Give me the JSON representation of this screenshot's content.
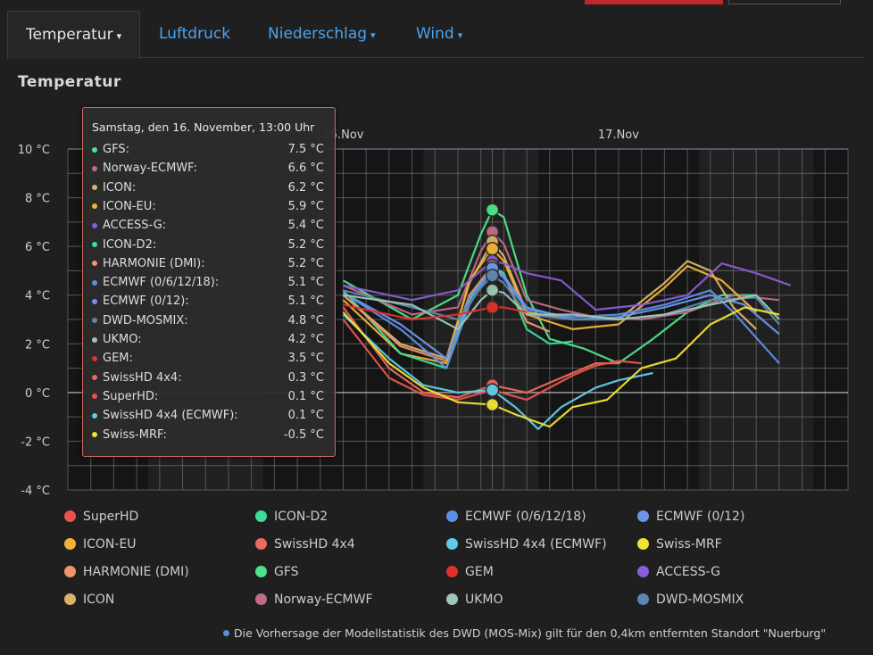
{
  "tabs": [
    {
      "label": "Temperatur",
      "caret": "▾"
    },
    {
      "label": "Luftdruck",
      "caret": ""
    },
    {
      "label": "Niederschlag",
      "caret": "▾"
    },
    {
      "label": "Wind",
      "caret": "▾"
    }
  ],
  "section_title": "Temperatur",
  "footnote": "Die Vorhersage der Modellstatistik des DWD (MOS-Mix) gilt für den 0,4km entfernten Standort \"Nuerburg\"",
  "tooltip": {
    "header": "Samstag, den 16. November, 13:00 Uhr",
    "rows": [
      {
        "name": "GFS:",
        "value": "7.5 °C",
        "color": "#4ee38a"
      },
      {
        "name": "Norway-ECMWF:",
        "value": "6.6 °C",
        "color": "#c06b86"
      },
      {
        "name": "ICON:",
        "value": "6.2 °C",
        "color": "#d9b36a"
      },
      {
        "name": "ICON-EU:",
        "value": "5.9 °C",
        "color": "#f2b233"
      },
      {
        "name": "ACCESS-G:",
        "value": "5.4 °C",
        "color": "#8a5cd6"
      },
      {
        "name": "ICON-D2:",
        "value": "5.2 °C",
        "color": "#3ddc97"
      },
      {
        "name": "HARMONIE (DMI):",
        "value": "5.2 °C",
        "color": "#f0956a"
      },
      {
        "name": "ECMWF (0/6/12/18):",
        "value": "5.1 °C",
        "color": "#5b8fe6"
      },
      {
        "name": "ECMWF (0/12):",
        "value": "5.1 °C",
        "color": "#6f93e8"
      },
      {
        "name": "DWD-MOSMIX:",
        "value": "4.8 °C",
        "color": "#5f86b0"
      },
      {
        "name": "UKMO:",
        "value": "4.2 °C",
        "color": "#9cc7b4"
      },
      {
        "name": "GEM:",
        "value": "3.5 °C",
        "color": "#e0312c"
      },
      {
        "name": "SwissHD 4x4:",
        "value": "0.3 °C",
        "color": "#ec6a5c"
      },
      {
        "name": "SuperHD:",
        "value": "0.1 °C",
        "color": "#e8534f"
      },
      {
        "name": "SwissHD 4x4 (ECMWF):",
        "value": "0.1 °C",
        "color": "#5fcbe8"
      },
      {
        "name": "Swiss-MRF:",
        "value": "-0.5 °C",
        "color": "#f2e233"
      }
    ]
  },
  "legend": [
    {
      "label": "SuperHD",
      "color": "#e8534f"
    },
    {
      "label": "ICON-D2",
      "color": "#3ddc97"
    },
    {
      "label": "ECMWF (0/6/12/18)",
      "color": "#5b8fe6"
    },
    {
      "label": "ECMWF (0/12)",
      "color": "#6f93e8"
    },
    {
      "label": "ICON-EU",
      "color": "#f2b233"
    },
    {
      "label": "SwissHD 4x4",
      "color": "#ec6a5c"
    },
    {
      "label": "SwissHD 4x4 (ECMWF)",
      "color": "#5fcbe8"
    },
    {
      "label": "Swiss-MRF",
      "color": "#f2e233"
    },
    {
      "label": "HARMONIE (DMI)",
      "color": "#f0956a"
    },
    {
      "label": "GFS",
      "color": "#4ee38a"
    },
    {
      "label": "GEM",
      "color": "#e0312c"
    },
    {
      "label": "ACCESS-G",
      "color": "#8a5cd6"
    },
    {
      "label": "ICON",
      "color": "#d9b36a"
    },
    {
      "label": "Norway-ECMWF",
      "color": "#c06b86"
    },
    {
      "label": "UKMO",
      "color": "#9cc7b4"
    },
    {
      "label": "DWD-MOSMIX",
      "color": "#5f86b0"
    }
  ],
  "chart_data": {
    "type": "line",
    "title": "Temperatur",
    "xlabel": "",
    "ylabel": "",
    "x_unit": "hour from 15 Nov 00:00",
    "x_range": [
      0,
      68
    ],
    "x_tick_labels": [
      {
        "label": "16.Nov",
        "x": 24
      },
      {
        "label": "17.Nov",
        "x": 48
      }
    ],
    "ylim": [
      -4,
      10
    ],
    "y_ticks": [
      -4,
      -2,
      0,
      2,
      4,
      6,
      8,
      10
    ],
    "y_tick_labels": [
      "-4 °C",
      "-2 °C",
      "0 °C",
      "2 °C",
      "4 °C",
      "6 °C",
      "8 °C",
      "10 °C"
    ],
    "grid": true,
    "highlight_x": 37,
    "series": [
      {
        "name": "GFS",
        "color": "#4ee38a",
        "points": [
          [
            24,
            4.6
          ],
          [
            30,
            3.0
          ],
          [
            34,
            4.0
          ],
          [
            36,
            6.5
          ],
          [
            37,
            7.5
          ],
          [
            38,
            7.2
          ],
          [
            40,
            4.0
          ],
          [
            42,
            2.2
          ],
          [
            45,
            1.8
          ],
          [
            48,
            1.2
          ],
          [
            51,
            2.2
          ],
          [
            54,
            3.3
          ],
          [
            57,
            4.0
          ],
          [
            60,
            4.0
          ]
        ]
      },
      {
        "name": "Norway-ECMWF",
        "color": "#c06b86",
        "points": [
          [
            24,
            4.4
          ],
          [
            30,
            3.2
          ],
          [
            34,
            3.5
          ],
          [
            36,
            5.8
          ],
          [
            37,
            6.6
          ],
          [
            38,
            6.1
          ],
          [
            40,
            3.8
          ],
          [
            43,
            3.4
          ],
          [
            46,
            3.1
          ],
          [
            50,
            3.0
          ],
          [
            54,
            3.3
          ],
          [
            58,
            4.0
          ],
          [
            62,
            3.8
          ]
        ]
      },
      {
        "name": "ICON",
        "color": "#d9b36a",
        "points": [
          [
            24,
            4.0
          ],
          [
            29,
            2.0
          ],
          [
            33,
            1.4
          ],
          [
            35,
            4.5
          ],
          [
            37,
            6.2
          ],
          [
            38,
            5.6
          ],
          [
            40,
            3.3
          ],
          [
            44,
            3.0
          ],
          [
            48,
            3.0
          ],
          [
            52,
            4.5
          ],
          [
            54,
            5.4
          ],
          [
            56,
            5.0
          ],
          [
            58,
            3.5
          ],
          [
            60,
            2.6
          ]
        ]
      },
      {
        "name": "ICON-EU",
        "color": "#f2b233",
        "points": [
          [
            24,
            3.8
          ],
          [
            29,
            1.6
          ],
          [
            33,
            1.2
          ],
          [
            35,
            4.6
          ],
          [
            37,
            5.9
          ],
          [
            38,
            5.4
          ],
          [
            40,
            3.2
          ],
          [
            44,
            2.6
          ],
          [
            48,
            2.8
          ],
          [
            52,
            4.3
          ],
          [
            54,
            5.2
          ],
          [
            57,
            4.6
          ],
          [
            60,
            3.3
          ]
        ]
      },
      {
        "name": "ACCESS-G",
        "color": "#8a5cd6",
        "points": [
          [
            24,
            4.4
          ],
          [
            30,
            3.8
          ],
          [
            34,
            4.2
          ],
          [
            36,
            5.0
          ],
          [
            37,
            5.4
          ],
          [
            38,
            5.3
          ],
          [
            40,
            4.9
          ],
          [
            43,
            4.6
          ],
          [
            46,
            3.4
          ],
          [
            50,
            3.6
          ],
          [
            54,
            4.0
          ],
          [
            57,
            5.3
          ],
          [
            60,
            4.9
          ],
          [
            63,
            4.4
          ]
        ]
      },
      {
        "name": "ICON-D2",
        "color": "#3ddc97",
        "points": [
          [
            24,
            4.2
          ],
          [
            29,
            1.6
          ],
          [
            33,
            1.0
          ],
          [
            35,
            3.8
          ],
          [
            37,
            5.2
          ],
          [
            38,
            4.9
          ],
          [
            40,
            2.6
          ],
          [
            42,
            2.0
          ],
          [
            44,
            2.1
          ]
        ]
      },
      {
        "name": "HARMONIE (DMI)",
        "color": "#f0956a",
        "points": [
          [
            24,
            4.0
          ],
          [
            29,
            1.9
          ],
          [
            33,
            1.3
          ],
          [
            35,
            4.0
          ],
          [
            37,
            5.2
          ],
          [
            38,
            4.8
          ],
          [
            40,
            2.9
          ],
          [
            42,
            2.5
          ]
        ]
      },
      {
        "name": "ECMWF (0/6/12/18)",
        "color": "#5b8fe6",
        "points": [
          [
            24,
            4.1
          ],
          [
            29,
            2.6
          ],
          [
            33,
            1.0
          ],
          [
            35,
            3.6
          ],
          [
            37,
            5.1
          ],
          [
            38,
            4.7
          ],
          [
            40,
            3.4
          ],
          [
            44,
            3.1
          ],
          [
            48,
            3.2
          ],
          [
            52,
            3.6
          ],
          [
            56,
            4.2
          ],
          [
            58,
            3.3
          ],
          [
            62,
            1.2
          ]
        ]
      },
      {
        "name": "ECMWF (0/12)",
        "color": "#6f93e8",
        "points": [
          [
            24,
            4.1
          ],
          [
            29,
            2.8
          ],
          [
            33,
            1.4
          ],
          [
            35,
            3.9
          ],
          [
            37,
            5.1
          ],
          [
            38,
            4.8
          ],
          [
            40,
            3.5
          ],
          [
            44,
            3.0
          ],
          [
            48,
            3.1
          ],
          [
            52,
            3.5
          ],
          [
            56,
            4.0
          ],
          [
            59,
            3.6
          ],
          [
            62,
            2.4
          ]
        ]
      },
      {
        "name": "DWD-MOSMIX",
        "color": "#5f86b0",
        "points": [
          [
            24,
            4.2
          ],
          [
            30,
            3.5
          ],
          [
            34,
            3.0
          ],
          [
            36,
            4.3
          ],
          [
            37,
            4.8
          ],
          [
            38,
            4.5
          ],
          [
            40,
            3.2
          ],
          [
            44,
            3.0
          ],
          [
            48,
            3.0
          ],
          [
            52,
            3.2
          ],
          [
            56,
            3.8
          ],
          [
            60,
            3.9
          ],
          [
            62,
            2.8
          ]
        ]
      },
      {
        "name": "UKMO",
        "color": "#9cc7b4",
        "points": [
          [
            24,
            4.0
          ],
          [
            30,
            3.6
          ],
          [
            34,
            2.6
          ],
          [
            36,
            3.8
          ],
          [
            37,
            4.2
          ],
          [
            38,
            4.1
          ],
          [
            40,
            3.2
          ],
          [
            44,
            3.2
          ],
          [
            48,
            3.0
          ],
          [
            52,
            3.2
          ],
          [
            56,
            3.6
          ],
          [
            60,
            4.0
          ],
          [
            62,
            3.0
          ]
        ]
      },
      {
        "name": "GEM",
        "color": "#e0312c",
        "points": [
          [
            24,
            3.6
          ],
          [
            30,
            3.0
          ],
          [
            34,
            3.2
          ],
          [
            36,
            3.4
          ],
          [
            37,
            3.5
          ],
          [
            38,
            3.5
          ],
          [
            40,
            3.3
          ]
        ]
      },
      {
        "name": "SwissHD 4x4",
        "color": "#ec6a5c",
        "points": [
          [
            24,
            3.5
          ],
          [
            28,
            1.0
          ],
          [
            31,
            0.0
          ],
          [
            34,
            -0.2
          ],
          [
            37,
            0.3
          ],
          [
            40,
            0.0
          ],
          [
            42,
            0.4
          ],
          [
            44,
            0.8
          ],
          [
            46,
            1.2
          ],
          [
            48,
            1.2
          ]
        ]
      },
      {
        "name": "SuperHD",
        "color": "#e8534f",
        "points": [
          [
            24,
            3.0
          ],
          [
            28,
            0.6
          ],
          [
            31,
            -0.1
          ],
          [
            34,
            -0.3
          ],
          [
            37,
            0.1
          ],
          [
            40,
            -0.3
          ],
          [
            42,
            0.2
          ],
          [
            44,
            0.7
          ],
          [
            46,
            1.1
          ],
          [
            48,
            1.3
          ],
          [
            50,
            1.2
          ]
        ]
      },
      {
        "name": "SwissHD 4x4 (ECMWF)",
        "color": "#5fcbe8",
        "points": [
          [
            24,
            3.2
          ],
          [
            28,
            1.4
          ],
          [
            31,
            0.3
          ],
          [
            34,
            0.0
          ],
          [
            37,
            0.1
          ],
          [
            39,
            -0.6
          ],
          [
            41,
            -1.5
          ],
          [
            43,
            -0.6
          ],
          [
            46,
            0.2
          ],
          [
            48,
            0.5
          ],
          [
            51,
            0.8
          ]
        ]
      },
      {
        "name": "Swiss-MRF",
        "color": "#f2e233",
        "points": [
          [
            24,
            3.3
          ],
          [
            28,
            1.2
          ],
          [
            31,
            0.2
          ],
          [
            34,
            -0.4
          ],
          [
            37,
            -0.5
          ],
          [
            39,
            -0.9
          ],
          [
            42,
            -1.4
          ],
          [
            44,
            -0.6
          ],
          [
            47,
            -0.3
          ],
          [
            50,
            1.0
          ],
          [
            53,
            1.4
          ],
          [
            56,
            2.8
          ],
          [
            59,
            3.5
          ],
          [
            62,
            3.2
          ]
        ]
      }
    ]
  }
}
